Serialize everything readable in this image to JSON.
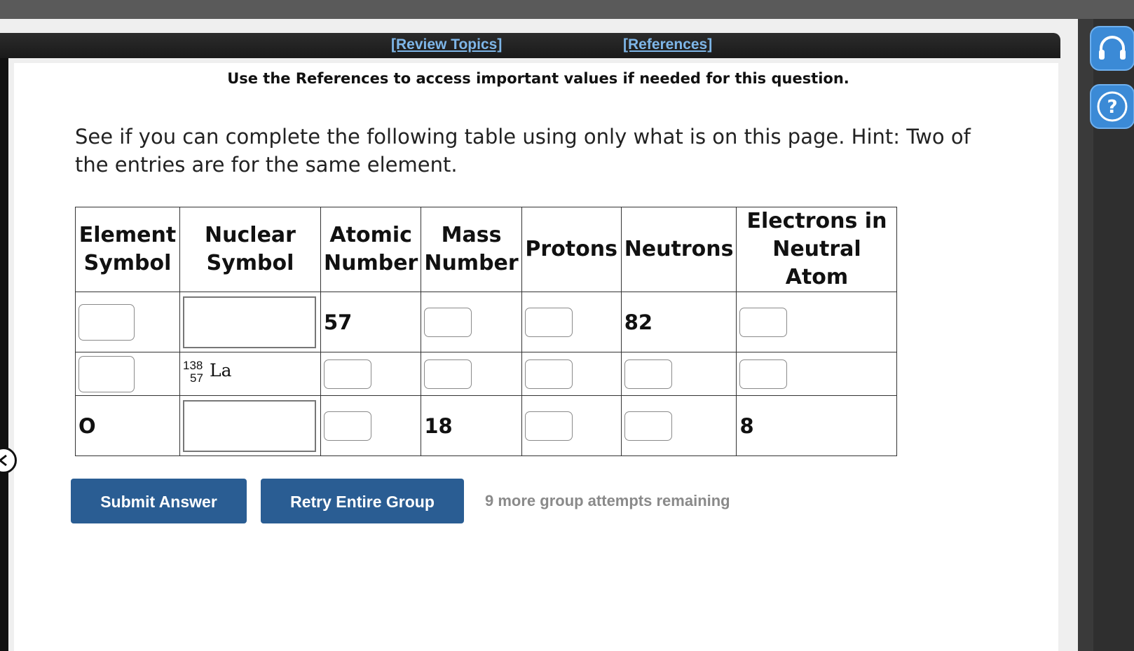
{
  "header": {
    "review_topics": "[Review Topics]",
    "references": "[References]"
  },
  "reference_note": "Use the References to access important values if needed for this question.",
  "question": "See if you can complete the following table using only what is on this page. Hint: Two of the entries are for the same element.",
  "table": {
    "headers": [
      [
        "Element",
        "Symbol"
      ],
      [
        "Nuclear",
        "Symbol"
      ],
      [
        "Atomic",
        "Number"
      ],
      [
        "Mass",
        "Number"
      ],
      [
        "Protons"
      ],
      [
        "Neutrons"
      ],
      [
        "Electrons in",
        "Neutral Atom"
      ]
    ],
    "rows": [
      {
        "atomic_number": "57",
        "neutrons": "82"
      },
      {
        "nuclear_symbol": {
          "mass": "138",
          "atomic": "57",
          "symbol": "La"
        }
      },
      {
        "element_symbol": "O",
        "mass_number": "18",
        "electrons": "8"
      }
    ]
  },
  "buttons": {
    "submit": "Submit Answer",
    "retry": "Retry Entire Group"
  },
  "attempts_text": "9 more group attempts remaining",
  "icons": {
    "support": "headset-icon",
    "help": "question-icon",
    "collapse": "chevron-left-icon"
  },
  "colors": {
    "button": "#2a5d93",
    "link": "#7eb6e8",
    "side_icon": "#3b8ad6"
  }
}
